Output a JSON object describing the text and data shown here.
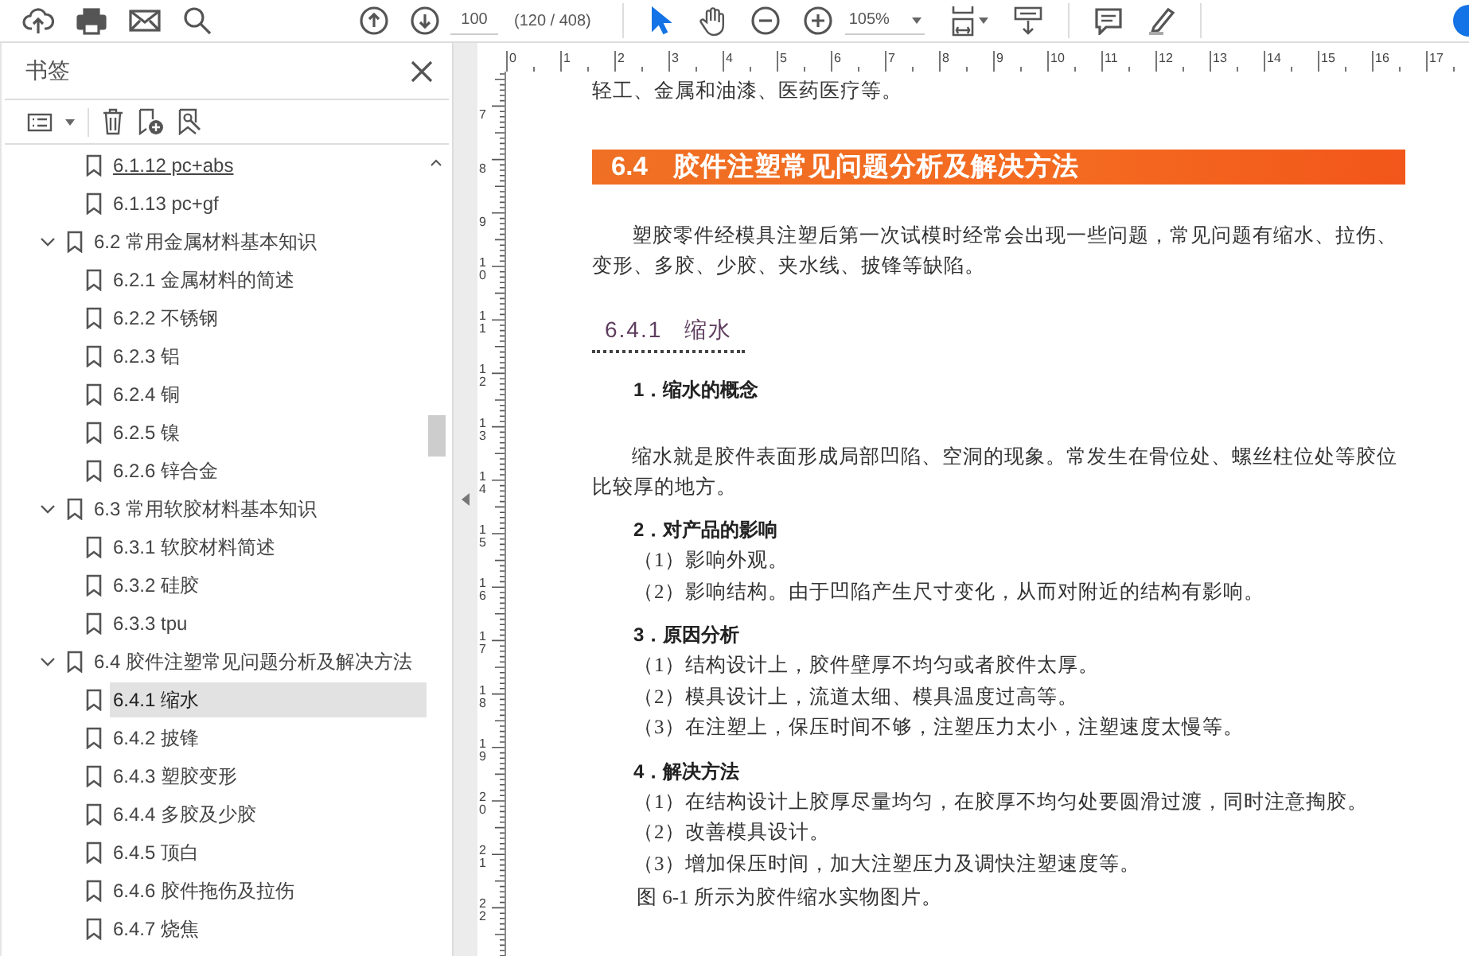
{
  "toolbar": {
    "page_number": "100",
    "page_count": "(120 / 408)",
    "zoom": "105%",
    "tools": [
      {
        "selected": true
      },
      {
        "selected": false
      }
    ]
  },
  "sidebar": {
    "title": "书签",
    "bookmarks": [
      {
        "kind": "page",
        "label": "6.1.12 pc+abs",
        "hovered": true,
        "selected": false
      },
      {
        "kind": "page",
        "label": "6.1.13 pc+gf",
        "hovered": false,
        "selected": false
      },
      {
        "kind": "section",
        "label": "6.2 常用金属材料基本知识",
        "expanded": true,
        "hovered": false,
        "selected": false,
        "children": [
          {
            "kind": "page",
            "label": "6.2.1 金属材料的简述",
            "hovered": false,
            "selected": false
          },
          {
            "kind": "page",
            "label": "6.2.2 不锈钢",
            "hovered": false,
            "selected": false
          },
          {
            "kind": "page",
            "label": "6.2.3 铝",
            "hovered": false,
            "selected": false
          },
          {
            "kind": "page",
            "label": "6.2.4 铜",
            "hovered": false,
            "selected": false
          },
          {
            "kind": "page",
            "label": "6.2.5 镍",
            "hovered": false,
            "selected": false
          },
          {
            "kind": "page",
            "label": "6.2.6 锌合金",
            "hovered": false,
            "selected": false
          }
        ]
      },
      {
        "kind": "section",
        "label": "6.3 常用软胶材料基本知识",
        "expanded": true,
        "hovered": false,
        "selected": false,
        "children": [
          {
            "kind": "page",
            "label": "6.3.1 软胶材料简述",
            "hovered": false,
            "selected": false
          },
          {
            "kind": "page",
            "label": "6.3.2 硅胶",
            "hovered": false,
            "selected": false
          },
          {
            "kind": "page",
            "label": "6.3.3 tpu",
            "hovered": false,
            "selected": false
          }
        ]
      },
      {
        "kind": "section",
        "label": "6.4 胶件注塑常见问题分析及解决方法",
        "expanded": true,
        "hovered": false,
        "selected": false,
        "children": [
          {
            "kind": "page",
            "label": "6.4.1 缩水",
            "hovered": false,
            "selected": true
          },
          {
            "kind": "page",
            "label": "6.4.2 披锋",
            "hovered": false,
            "selected": false
          },
          {
            "kind": "page",
            "label": "6.4.3 塑胶变形",
            "hovered": false,
            "selected": false
          },
          {
            "kind": "page",
            "label": "6.4.4 多胶及少胶",
            "hovered": false,
            "selected": false
          },
          {
            "kind": "page",
            "label": "6.4.5 顶白",
            "hovered": false,
            "selected": false
          },
          {
            "kind": "page",
            "label": "6.4.6 胶件拖伤及拉伤",
            "hovered": false,
            "selected": false
          },
          {
            "kind": "page",
            "label": "6.4.7 烧焦",
            "hovered": false,
            "selected": false
          }
        ]
      }
    ]
  },
  "rulers": {
    "horizontal": [
      "0",
      "1",
      "2",
      "3",
      "4",
      "5",
      "6",
      "7",
      "8",
      "9",
      "10",
      "11",
      "12",
      "13",
      "14",
      "15",
      "16",
      "17"
    ],
    "vertical": [
      "7",
      "8",
      "9",
      "10",
      "11",
      "12",
      "13",
      "14",
      "15",
      "16",
      "17",
      "18",
      "19",
      "20",
      "21",
      "22"
    ]
  },
  "page": {
    "blocks": [
      {
        "kind": "text",
        "text": "轻工、金属和油漆、医药医疗等。"
      },
      {
        "kind": "banner",
        "number": "6.4",
        "text": "胶件注塑常见问题分析及解决方法"
      },
      {
        "kind": "para",
        "text": "塑胶零件经模具注塑后第一次试模时经常会出现一些问题，常见问题有缩水、拉伤、变形、多胶、少胶、夹水线、披锋等缺陷。"
      },
      {
        "kind": "subsection",
        "number": "6.4.1",
        "text": "缩水"
      },
      {
        "kind": "heading",
        "text": "1．缩水的概念"
      },
      {
        "kind": "para",
        "text": "缩水就是胶件表面形成局部凹陷、空洞的现象。常发生在骨位处、螺丝柱位处等胶位比较厚的地方。"
      },
      {
        "kind": "heading",
        "text": "2．对产品的影响"
      },
      {
        "kind": "item",
        "text": "（1）影响外观。"
      },
      {
        "kind": "item",
        "text": "（2）影响结构。由于凹陷产生尺寸变化，从而对附近的结构有影响。"
      },
      {
        "kind": "heading",
        "text": "3．原因分析"
      },
      {
        "kind": "item",
        "text": "（1）结构设计上，胶件壁厚不均匀或者胶件太厚。"
      },
      {
        "kind": "item",
        "text": "（2）模具设计上，流道太细、模具温度过高等。"
      },
      {
        "kind": "item",
        "text": "（3）在注塑上，保压时间不够，注塑压力太小，注塑速度太慢等。"
      },
      {
        "kind": "heading",
        "text": "4．解决方法"
      },
      {
        "kind": "item",
        "text": "（1）在结构设计上胶厚尽量均匀，在胶厚不均匀处要圆滑过渡，同时注意掏胶。"
      },
      {
        "kind": "item",
        "text": "（2）改善模具设计。"
      },
      {
        "kind": "item",
        "text": "（3）增加保压时间，加大注塑压力及调快注塑速度等。"
      },
      {
        "kind": "caption",
        "text": "图 6-1 所示为胶件缩水实物图片。"
      }
    ]
  }
}
